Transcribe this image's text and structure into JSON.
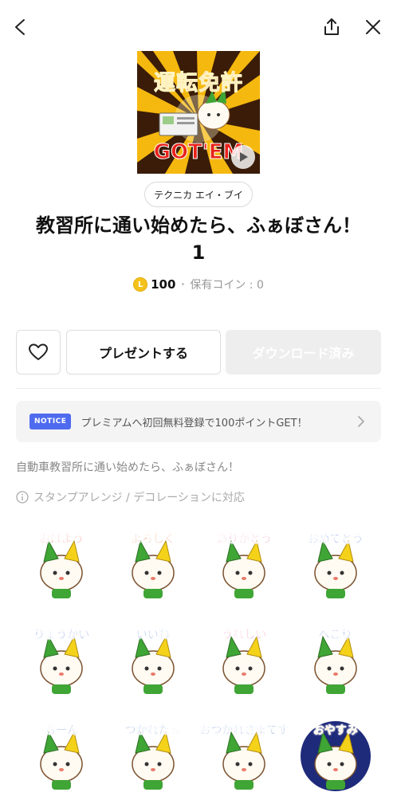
{
  "header": {
    "back_icon": "chevron-left-icon",
    "share_icon": "share-icon",
    "close_icon": "close-icon"
  },
  "thumbnail": {
    "title_text": "運転免許",
    "gotem_text": "GOT'EM",
    "play_icon": "play-icon"
  },
  "author": "テクニカ エイ・ブイ",
  "title": "教習所に通い始めたら、ふぁぼさん！ 1",
  "price": {
    "coin_label": "L",
    "amount": "100",
    "owned": "保有コイン : 0"
  },
  "actions": {
    "favorite_icon": "heart-icon",
    "present_label": "プレゼントする",
    "download_label": "ダウンロード済み"
  },
  "notice": {
    "badge": "NOTICE",
    "text": "プレミアムへ初回無料登録で100ポイントGET！"
  },
  "description": "自動車教習所に通い始めたら、ふぁぼさん！",
  "info": "スタンプアレンジ / デコレーションに対応",
  "stickers": [
    {
      "text": "おはよう"
    },
    {
      "text": "よろしく"
    },
    {
      "text": "ありがとう"
    },
    {
      "text": "おめでとう"
    },
    {
      "text": "りょうかい"
    },
    {
      "text": "いいね"
    },
    {
      "text": "うれしい"
    },
    {
      "text": "ぺこり"
    },
    {
      "text": "ちーん"
    },
    {
      "text": "つかれたぁ"
    },
    {
      "text": "おつかれさまです"
    },
    {
      "text": "おやすみ"
    }
  ],
  "colors": {
    "accent_blue": "#4e6bef",
    "coin_yellow": "#f4c21b",
    "mascot_green": "#3fa535",
    "mascot_yellow": "#f5d21a",
    "title_red": "#e8221a"
  }
}
